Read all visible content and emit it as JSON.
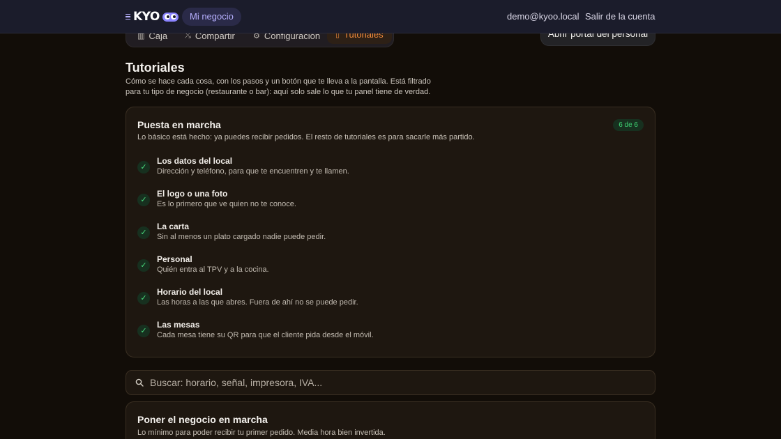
{
  "header": {
    "brand": "KYO",
    "business_pill": "Mi negocio",
    "user_email": "demo@kyoo.local",
    "logout_label": "Salir de la cuenta"
  },
  "nav": {
    "tabs": [
      {
        "label": "Caja",
        "icon": "register-icon"
      },
      {
        "label": "Compartir",
        "icon": "share-icon"
      },
      {
        "label": "Configuración",
        "icon": "gear-icon"
      },
      {
        "label": "Tutoriales",
        "icon": "book-icon",
        "active": true
      }
    ],
    "portal_button": "Abrir portal del personal"
  },
  "page": {
    "title": "Tutoriales",
    "description": "Cómo se hace cada cosa, con los pasos y un botón que te lleva a la pantalla. Está filtrado para tu tipo de negocio (restaurante o bar): aquí solo sale lo que tu panel tiene de verdad."
  },
  "onboarding": {
    "title": "Puesta en marcha",
    "subtitle": "Lo básico está hecho: ya puedes recibir pedidos. El resto de tutoriales es para sacarle más partido.",
    "progress_label": "6 de 6",
    "completed": 6,
    "total": 6,
    "steps": [
      {
        "title": "Los datos del local",
        "desc": "Dirección y teléfono, para que te encuentren y te llamen.",
        "done": true
      },
      {
        "title": "El logo o una foto",
        "desc": "Es lo primero que ve quien no te conoce.",
        "done": true
      },
      {
        "title": "La carta",
        "desc": "Sin al menos un plato cargado nadie puede pedir.",
        "done": true
      },
      {
        "title": "Personal",
        "desc": "Quién entra al TPV y a la cocina.",
        "done": true
      },
      {
        "title": "Horario del local",
        "desc": "Las horas a las que abres. Fuera de ahí no se puede pedir.",
        "done": true
      },
      {
        "title": "Las mesas",
        "desc": "Cada mesa tiene su QR para que el cliente pida desde el móvil.",
        "done": true
      }
    ]
  },
  "search": {
    "placeholder": "Buscar: horario, señal, impresora, IVA...",
    "value": ""
  },
  "section": {
    "title": "Poner el negocio en marcha",
    "subtitle": "Lo mínimo para poder recibir tu primer pedido. Media hora bien invertida."
  },
  "colors": {
    "accent": "#f08a3c",
    "brand": "#8b84ff",
    "success": "#3fd474",
    "background": "#120d08",
    "card": "#1e1710"
  }
}
